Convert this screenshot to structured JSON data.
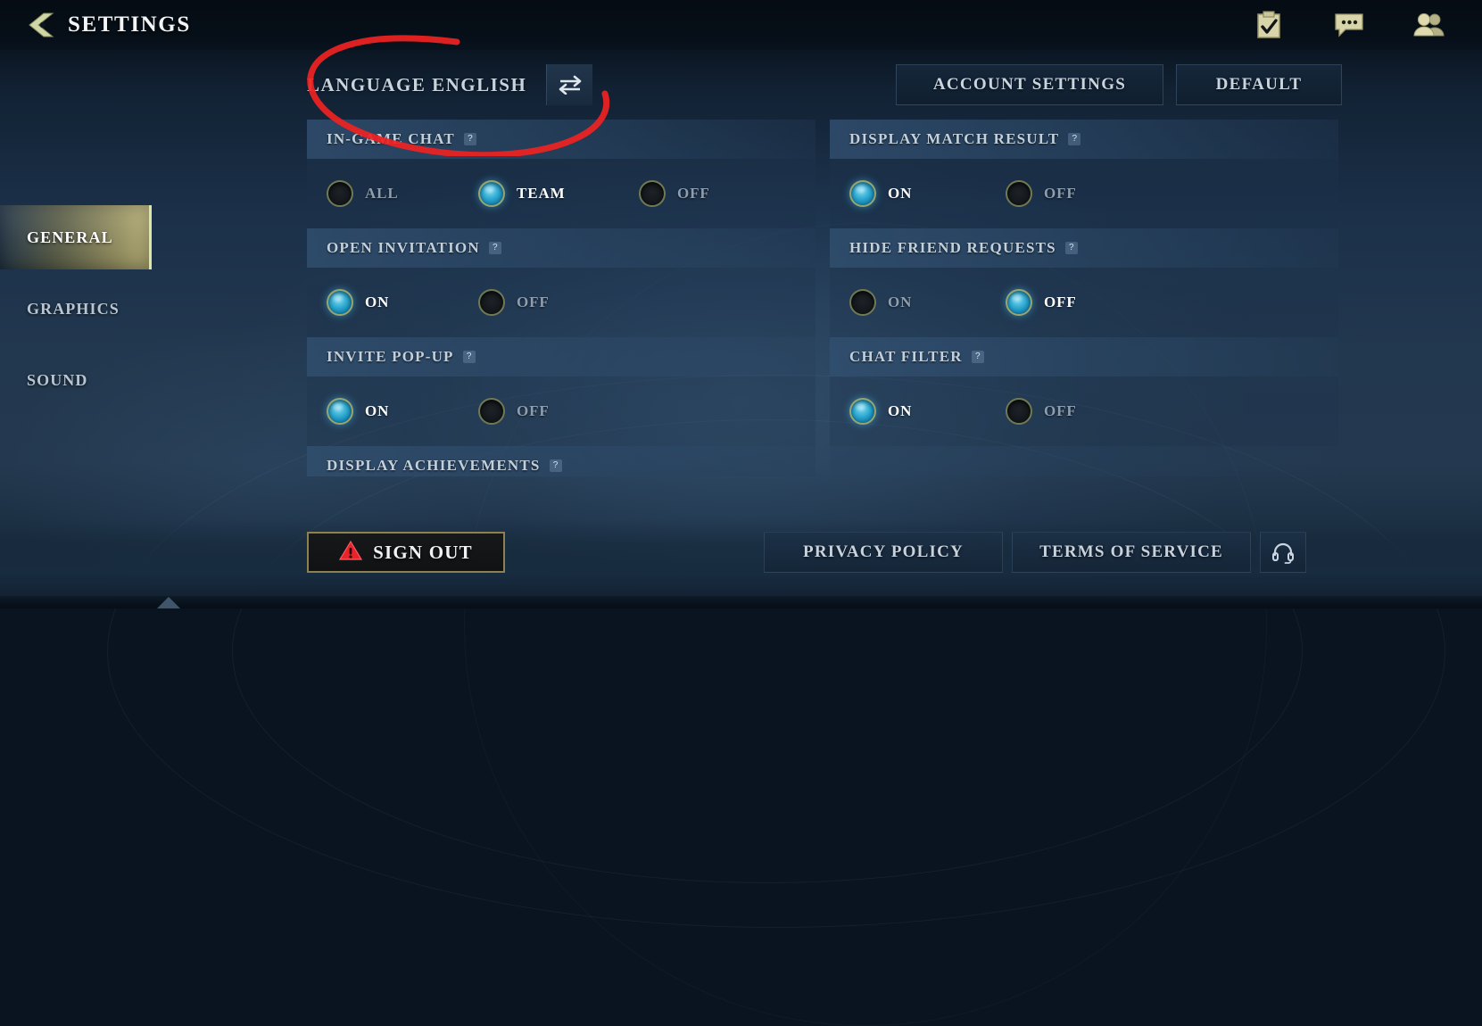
{
  "header": {
    "title": "SETTINGS",
    "back_icon": "chevron-left-icon",
    "icons": [
      {
        "name": "tasks-checklist-icon",
        "glyph": "checklist"
      },
      {
        "name": "chat-bubble-icon",
        "glyph": "chat"
      },
      {
        "name": "friends-people-icon",
        "glyph": "friends"
      }
    ]
  },
  "sidebar": {
    "items": [
      {
        "label": "GENERAL",
        "active": true
      },
      {
        "label": "GRAPHICS",
        "active": false
      },
      {
        "label": "SOUND",
        "active": false
      }
    ]
  },
  "language": {
    "label": "LANGUAGE ENGLISH",
    "swap_icon": "swap-arrows-icon"
  },
  "top_actions": {
    "account_settings": "ACCOUNT SETTINGS",
    "default": "DEFAULT"
  },
  "help_glyph": "?",
  "settings": [
    {
      "title": "IN-GAME CHAT",
      "column": "left",
      "options": [
        {
          "label": "ALL",
          "selected": false
        },
        {
          "label": "TEAM",
          "selected": true
        },
        {
          "label": "OFF",
          "selected": false
        }
      ]
    },
    {
      "title": "DISPLAY MATCH RESULT",
      "column": "right",
      "options": [
        {
          "label": "ON",
          "selected": true
        },
        {
          "label": "OFF",
          "selected": false
        }
      ]
    },
    {
      "title": "OPEN INVITATION",
      "column": "left",
      "options": [
        {
          "label": "ON",
          "selected": true
        },
        {
          "label": "OFF",
          "selected": false
        }
      ]
    },
    {
      "title": "HIDE FRIEND REQUESTS",
      "column": "right",
      "options": [
        {
          "label": "ON",
          "selected": false
        },
        {
          "label": "OFF",
          "selected": true
        }
      ]
    },
    {
      "title": "INVITE POP-UP",
      "column": "left",
      "options": [
        {
          "label": "ON",
          "selected": true
        },
        {
          "label": "OFF",
          "selected": false
        }
      ]
    },
    {
      "title": "CHAT FILTER",
      "column": "right",
      "options": [
        {
          "label": "ON",
          "selected": true
        },
        {
          "label": "OFF",
          "selected": false
        }
      ]
    }
  ],
  "partial_row": {
    "title": "DISPLAY ACHIEVEMENTS"
  },
  "bottom_bar": {
    "sign_out": "SIGN OUT",
    "sign_out_icon": "warning-triangle-icon",
    "privacy_policy": "PRIVACY POLICY",
    "terms_of_service": "TERMS OF SERVICE",
    "support_icon": "headset-support-icon"
  },
  "colors": {
    "accent_gold": "#cbbd7a",
    "radio_on": "#2aa6cf",
    "panel_header": "#2a4664",
    "warning_red": "#e8242a",
    "annotation_red": "#ee2222"
  }
}
